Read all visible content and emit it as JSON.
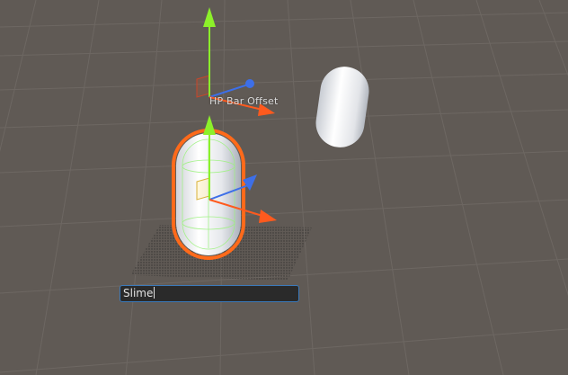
{
  "scene": {
    "gizmo_label": "HP Bar Offset",
    "rename_field": {
      "value": "Slime"
    },
    "objects": [
      {
        "name": "Slime",
        "shape": "capsule",
        "selected": true
      },
      {
        "name": "",
        "shape": "capsule",
        "selected": false
      },
      {
        "name": "HP Bar Offset",
        "shape": "empty",
        "selected": false
      }
    ]
  },
  "colors": {
    "background": "#605a55",
    "grid": "#6f6964",
    "selection_outline": "#ff6a1a",
    "axis_x": "#ff5a1e",
    "axis_y": "#8cf02a",
    "axis_z": "#3d6fe8",
    "shadow_dots": "#2d2b2a",
    "collider_wire": "#9cf27e"
  },
  "icons": [
    "move-y-arrow-icon",
    "move-x-arrow-icon",
    "move-z-arrow-icon",
    "plane-handle-icon"
  ]
}
